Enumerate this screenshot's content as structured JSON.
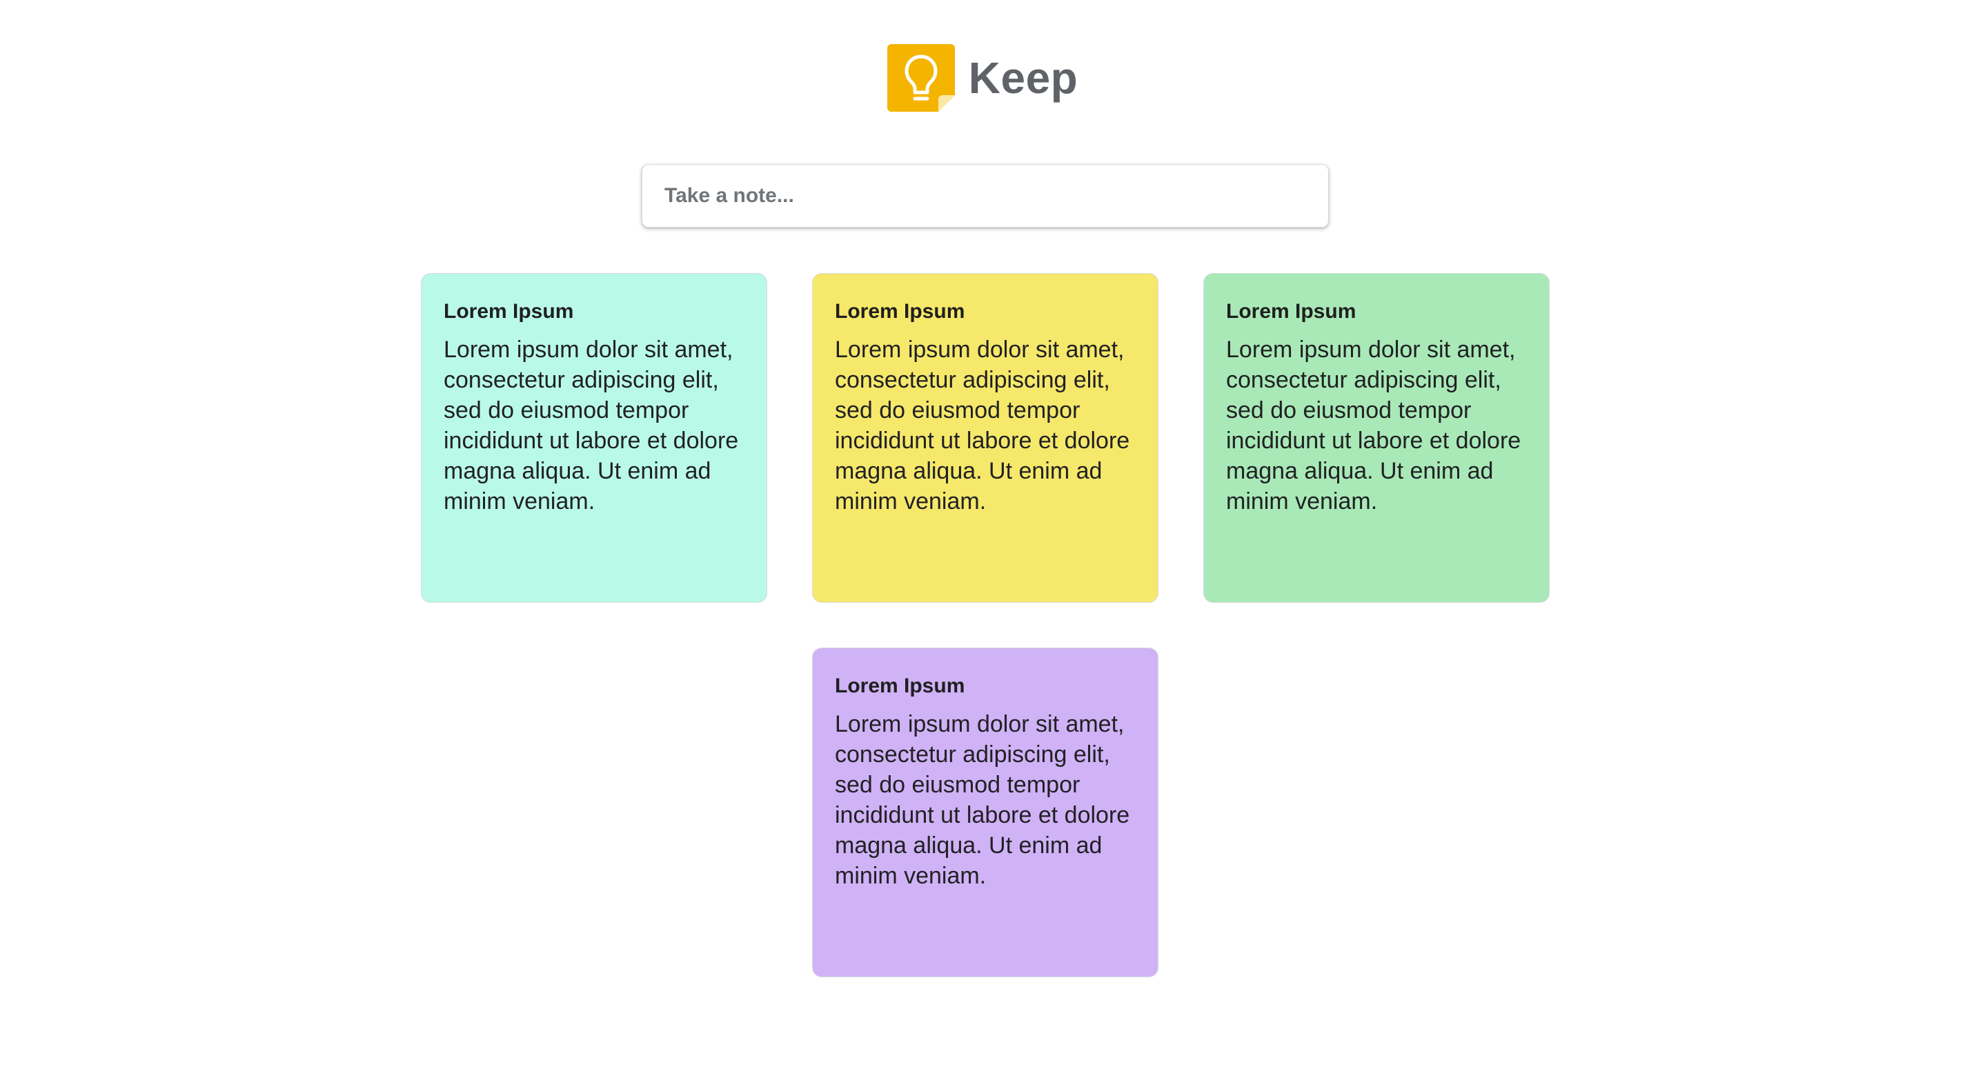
{
  "header": {
    "app_title": "Keep",
    "logo_icon": "lightbulb-icon",
    "logo_color": "#F4B400"
  },
  "search": {
    "placeholder": "Take a note...",
    "value": ""
  },
  "notes": [
    {
      "title": "Lorem Ipsum",
      "body": "Lorem ipsum dolor sit amet, consectetur adipiscing elit, sed do eiusmod tempor incididunt ut labore et dolore magna aliqua. Ut enim ad minim veniam.",
      "color": "#B9F9E8"
    },
    {
      "title": "Lorem Ipsum",
      "body": "Lorem ipsum dolor sit amet, consectetur adipiscing elit, sed do eiusmod tempor incididunt ut labore et dolore magna aliqua. Ut enim ad minim veniam.",
      "color": "#F6E86A"
    },
    {
      "title": "Lorem Ipsum",
      "body": "Lorem ipsum dolor sit amet, consectetur adipiscing elit, sed do eiusmod tempor incididunt ut labore et dolore magna aliqua. Ut enim ad minim veniam.",
      "color": "#A9E9B7"
    },
    {
      "title": "Lorem Ipsum",
      "body": "Lorem ipsum dolor sit amet, consectetur adipiscing elit, sed do eiusmod tempor incididunt ut labore et dolore magna aliqua. Ut enim ad minim veniam.",
      "color": "#D0B2F6"
    }
  ]
}
